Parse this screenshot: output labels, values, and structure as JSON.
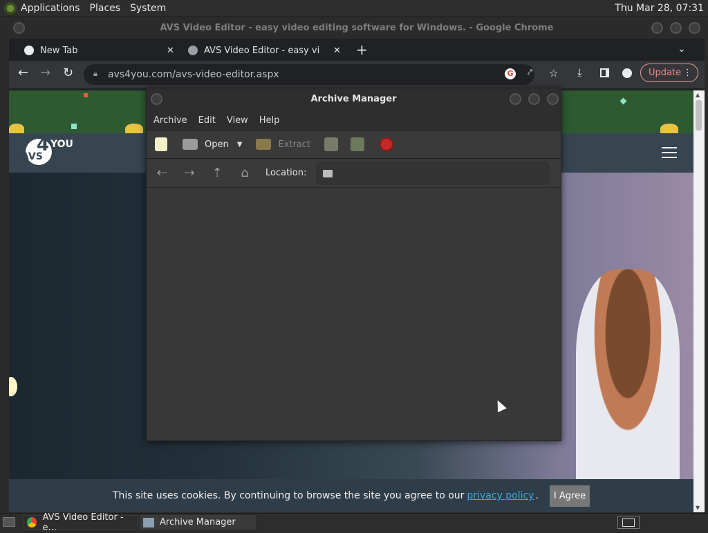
{
  "top_panel": {
    "menus": [
      "Applications",
      "Places",
      "System"
    ],
    "clock": "Thu Mar 28, 07:31"
  },
  "chrome": {
    "window_title": "AVS Video Editor - easy video editing software for Windows. - Google Chrome",
    "tabs": [
      {
        "label": "New Tab"
      },
      {
        "label": "AVS Video Editor - easy video"
      }
    ],
    "url": "avs4you.com/avs-video-editor.aspx",
    "update_label": "Update"
  },
  "website": {
    "logo_text_small": "AVS",
    "logo_number": "4",
    "logo_you": "YOU",
    "cookie_text": "This site uses cookies. By continuing to browse the site you agree to our",
    "cookie_link": "privacy policy",
    "cookie_period": ".",
    "agree_label": "I Agree"
  },
  "archive_manager": {
    "title": "Archive Manager",
    "menus": [
      "Archive",
      "Edit",
      "View",
      "Help"
    ],
    "toolbar": {
      "open_label": "Open",
      "extract_label": "Extract"
    },
    "location_label": "Location:"
  },
  "taskbar": {
    "items": [
      "AVS Video Editor - e...",
      "Archive Manager"
    ]
  }
}
